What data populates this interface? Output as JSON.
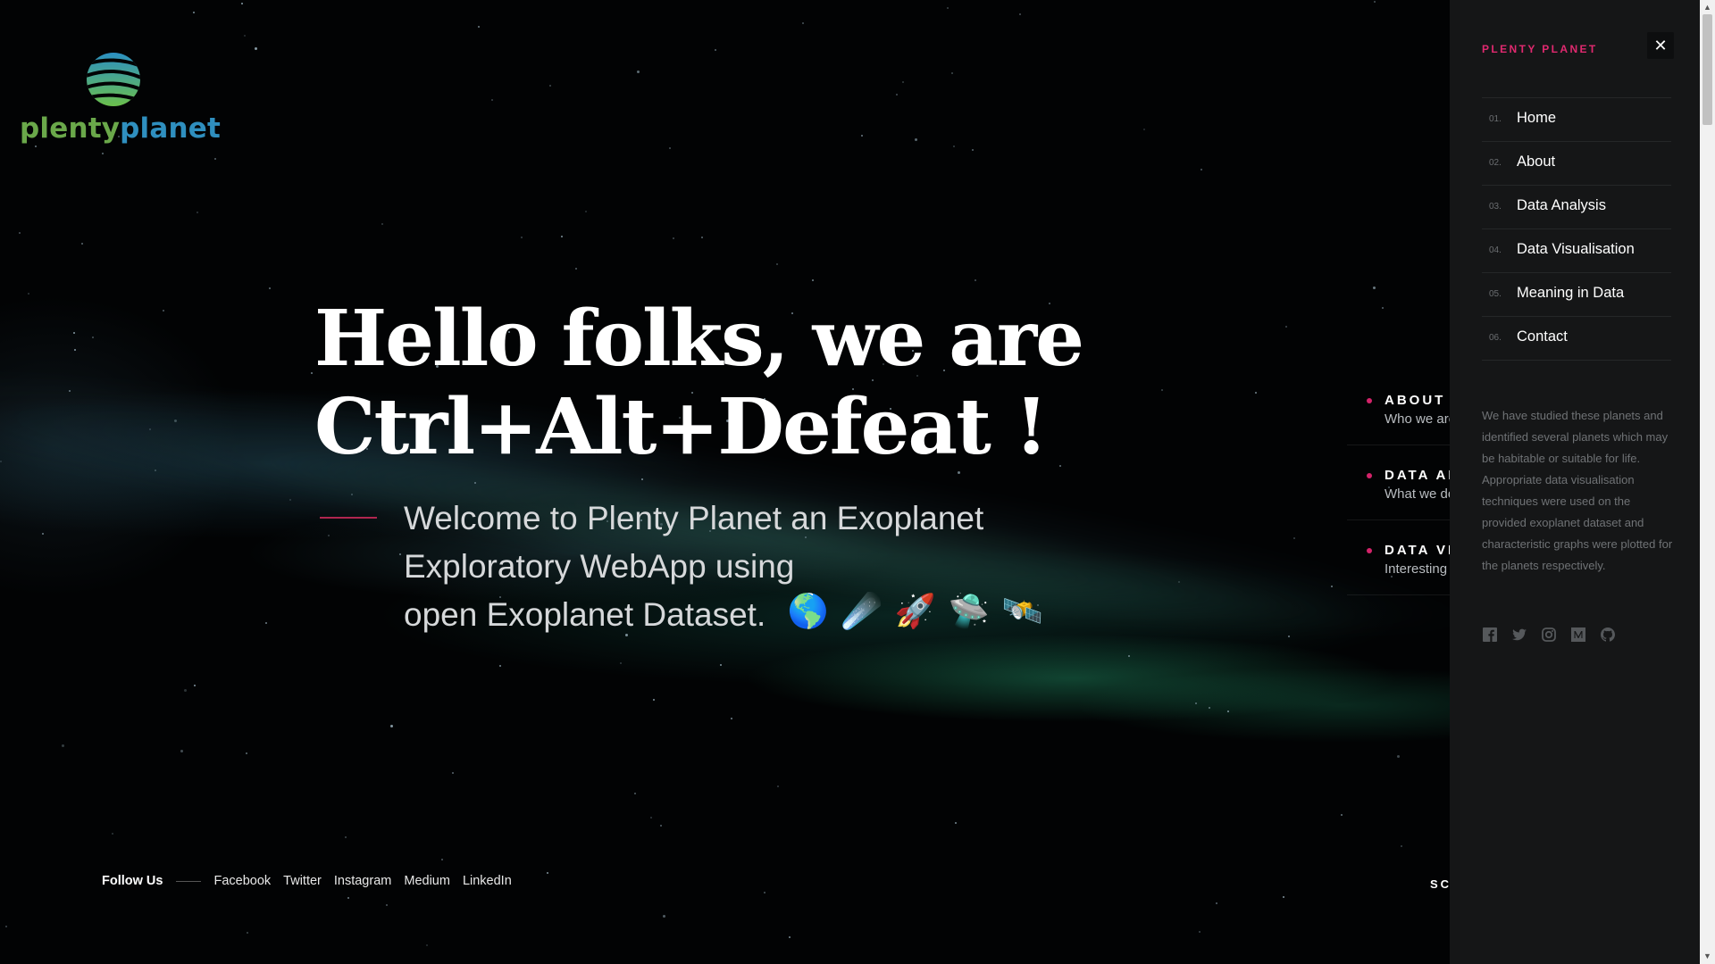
{
  "logo": {
    "part1": "plenty",
    "part2": "planet"
  },
  "hero": {
    "title_line1": "Hello folks, we are",
    "title_line2": "Ctrl+Alt+Defeat !",
    "subtitle_line1": "Welcome to Plenty Planet an Exoplanet",
    "subtitle_line2": "Exploratory WebApp using",
    "subtitle_line3": "open Exoplanet Dataset.",
    "emojis": [
      "🌎",
      "☄️",
      "🚀",
      "🛸",
      "🛰️"
    ]
  },
  "sections": [
    {
      "title": "ABOUT",
      "desc": "Who we are"
    },
    {
      "title": "DATA ANALYSIS",
      "desc": "What we do"
    },
    {
      "title": "DATA VISUALISATION",
      "desc": "Interesting graphs"
    }
  ],
  "scroll_label": "SCROLL",
  "follow": {
    "label": "Follow Us",
    "links": [
      "Facebook",
      "Twitter",
      "Instagram",
      "Medium",
      "LinkedIn"
    ]
  },
  "drawer": {
    "brand": "PLENTY PLANET",
    "close": "✕",
    "menu": [
      {
        "num": "01.",
        "label": "Home"
      },
      {
        "num": "02.",
        "label": "About"
      },
      {
        "num": "03.",
        "label": "Data Analysis"
      },
      {
        "num": "04.",
        "label": "Data Visualisation"
      },
      {
        "num": "05.",
        "label": "Meaning in Data"
      },
      {
        "num": "06.",
        "label": "Contact"
      }
    ],
    "text": "We have studied these planets and identified several planets which may be habitable or suitable for life. Appropriate data visualisation techniques were used on the provided exoplanet dataset and characteristic graphs were plotted for the planets respectively.",
    "social_icons": [
      "facebook-icon",
      "twitter-icon",
      "instagram-icon",
      "medium-icon",
      "github-icon"
    ]
  },
  "colors": {
    "accent": "#e0296f",
    "drawer_bg": "#151617",
    "logo_green": "#6aa84a",
    "logo_blue": "#2f8fbf"
  }
}
